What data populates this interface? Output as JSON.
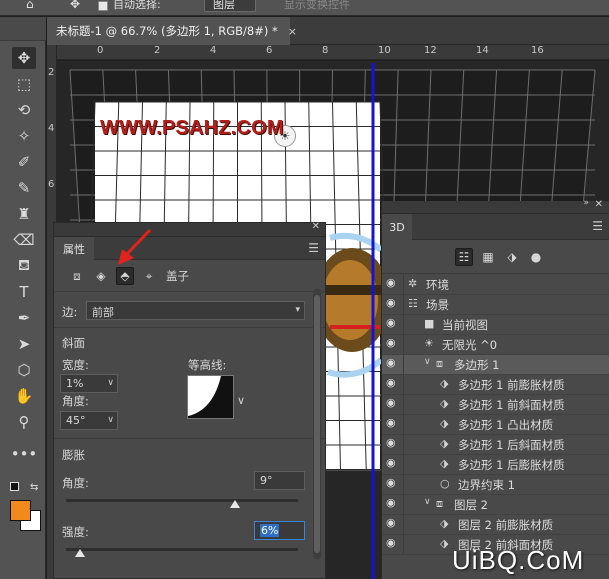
{
  "options_bar": {
    "auto_select_label": "自动选择:",
    "auto_select_target": "图层",
    "show_transform_label": "显示变换控件"
  },
  "document_tab": {
    "title": "未标题-1 @ 66.7% (多边形 1, RGB/8#) *",
    "close": "×"
  },
  "ruler": {
    "h_ticks": [
      "0",
      "2",
      "4",
      "6",
      "8",
      "10",
      "12",
      "14",
      "16"
    ],
    "v_ticks": [
      "2",
      "4",
      "6"
    ]
  },
  "canvas": {
    "watermark": "WWW.PSAHZ.COM"
  },
  "properties": {
    "tab_label": "属性",
    "section_label": "盖子",
    "side_label": "边:",
    "side_value": "前部",
    "bevel_title": "斜面",
    "width_label": "宽度:",
    "width_value": "1%",
    "angle_label": "角度:",
    "angle_value": "45°",
    "contour_label": "等高线:",
    "inflate_title": "膨胀",
    "inflate_angle_label": "角度:",
    "inflate_angle_value": "9°",
    "inflate_angle_level": 0.73,
    "strength_label": "强度:",
    "strength_value": "6%",
    "strength_level": 0.06
  },
  "panel3d": {
    "tab_label": "3D",
    "rows": [
      {
        "label": "环境",
        "icon": "environment-icon",
        "glyph": "✲",
        "indent": 0,
        "twisty": ""
      },
      {
        "label": "场景",
        "icon": "scene-icon",
        "glyph": "☷",
        "indent": 0,
        "twisty": ""
      },
      {
        "label": "当前视图",
        "icon": "camera-icon",
        "glyph": "■",
        "indent": 1,
        "twisty": ""
      },
      {
        "label": "无限光 ^0",
        "icon": "light-icon",
        "glyph": "☀",
        "indent": 1,
        "twisty": ""
      },
      {
        "label": "多边形 1",
        "icon": "mesh-icon",
        "glyph": "⧈",
        "indent": 1,
        "twisty": "∨",
        "highlight": true
      },
      {
        "label": "多边形 1 前膨胀材质",
        "icon": "material-icon",
        "glyph": "⬗",
        "indent": 2,
        "twisty": ""
      },
      {
        "label": "多边形 1 前斜面材质",
        "icon": "material-icon",
        "glyph": "⬗",
        "indent": 2,
        "twisty": ""
      },
      {
        "label": "多边形 1 凸出材质",
        "icon": "material-icon",
        "glyph": "⬗",
        "indent": 2,
        "twisty": ""
      },
      {
        "label": "多边形 1 后斜面材质",
        "icon": "material-icon",
        "glyph": "⬗",
        "indent": 2,
        "twisty": ""
      },
      {
        "label": "多边形 1 后膨胀材质",
        "icon": "material-icon",
        "glyph": "⬗",
        "indent": 2,
        "twisty": ""
      },
      {
        "label": "边界约束 1",
        "icon": "constraint-icon",
        "glyph": "○",
        "indent": 2,
        "twisty": ""
      },
      {
        "label": "图层 2",
        "icon": "mesh-icon",
        "glyph": "⧈",
        "indent": 1,
        "twisty": "∨"
      },
      {
        "label": "图层 2 前膨胀材质",
        "icon": "material-icon",
        "glyph": "⬗",
        "indent": 2,
        "twisty": ""
      },
      {
        "label": "图层 2 前斜面材质",
        "icon": "material-icon",
        "glyph": "⬗",
        "indent": 2,
        "twisty": ""
      }
    ]
  },
  "colors": {
    "foreground": "#f08a1c",
    "background": "#ffffff",
    "guide_blue": "#1414d8",
    "watermark_red": "#b2201c",
    "annotation_arrow": "#e0241c"
  },
  "site_mark": "UiBQ.CoM"
}
